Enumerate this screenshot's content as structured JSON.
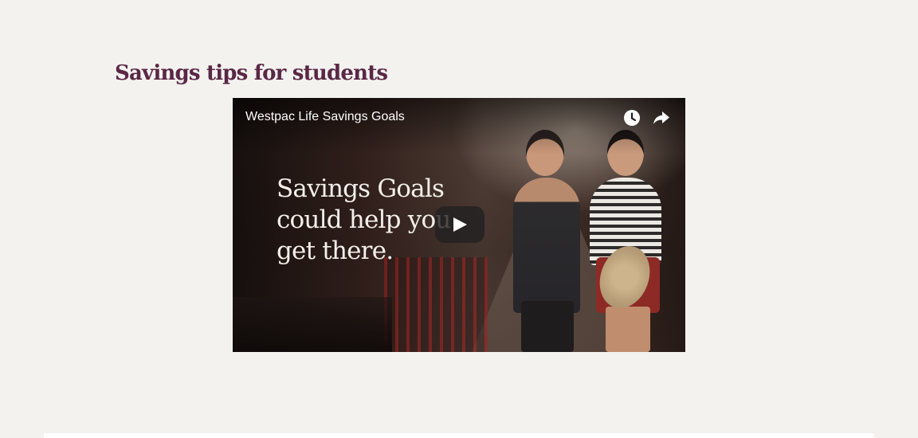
{
  "section": {
    "title": "Savings tips for students"
  },
  "video": {
    "title": "Westpac Life Savings Goals",
    "thumbnail_text": "Savings Goals\ncould help you\nget there.",
    "controls": {
      "watch_later_icon": "clock-icon",
      "share_icon": "share-arrow-icon",
      "play_icon": "play-icon"
    }
  },
  "colors": {
    "page_background": "#f3f2ef",
    "heading": "#5a2745",
    "card": "#ffffff"
  }
}
